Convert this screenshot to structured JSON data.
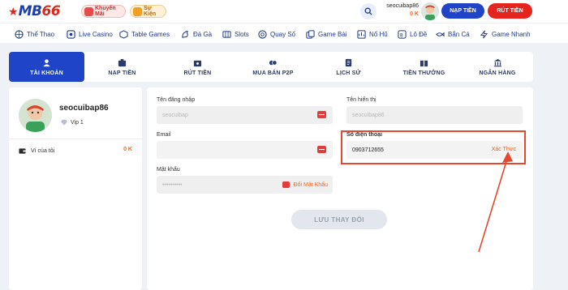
{
  "brand": {
    "logo_text": "MB",
    "logo_num": "66"
  },
  "header": {
    "promo_chip": "Khuyến Mãi",
    "event_chip": "Sự Kiện",
    "username": "seocuibap86",
    "balance": "0 K",
    "deposit_label": "NẠP TIỀN",
    "withdraw_label": "RÚT TIỀN"
  },
  "nav": [
    {
      "label": "Thể Thao",
      "icon": "sports-icon"
    },
    {
      "label": "Live Casino",
      "icon": "live-casino-icon"
    },
    {
      "label": "Table Games",
      "icon": "table-games-icon"
    },
    {
      "label": "Đá Gà",
      "icon": "cockfight-icon"
    },
    {
      "label": "Slots",
      "icon": "slots-icon"
    },
    {
      "label": "Quay Số",
      "icon": "lottery-icon"
    },
    {
      "label": "Game Bài",
      "icon": "cards-icon"
    },
    {
      "label": "Nổ Hũ",
      "icon": "jackpot-icon"
    },
    {
      "label": "Lô Đề",
      "icon": "lo-de-icon"
    },
    {
      "label": "Bắn Cá",
      "icon": "fishing-icon"
    },
    {
      "label": "Game Nhanh",
      "icon": "fast-game-icon"
    }
  ],
  "tabs": [
    {
      "label": "TÀI KHOẢN",
      "active": true
    },
    {
      "label": "NẠP TIỀN",
      "active": false
    },
    {
      "label": "RÚT TIỀN",
      "active": false
    },
    {
      "label": "MUA BÁN P2P",
      "active": false
    },
    {
      "label": "LỊCH SỬ",
      "active": false
    },
    {
      "label": "TIỀN THƯỞNG",
      "active": false
    },
    {
      "label": "NGÂN HÀNG",
      "active": false
    }
  ],
  "profile": {
    "name": "seocuibap86",
    "vip": "Vip 1",
    "wallet_label": "Ví của tôi",
    "wallet_balance": "0 K"
  },
  "form": {
    "login_label": "Tên đăng nhập",
    "login_value": "seocuibap",
    "display_label": "Tên hiển thị",
    "display_value": "seocuibap86",
    "email_label": "Email",
    "email_value": "",
    "phone_label": "Số điện thoại",
    "phone_value": "0903712655",
    "verify_label": "Xác Thực",
    "password_label": "Mật khẩu",
    "password_value": "••••••••••",
    "change_password_label": "Đổi Mật Khẩu",
    "save_label": "LƯU THAY ĐỔI"
  },
  "colors": {
    "primary": "#1f44c8",
    "danger": "#e5251d",
    "accent_orange": "#f0641e",
    "highlight": "#e4482e"
  }
}
